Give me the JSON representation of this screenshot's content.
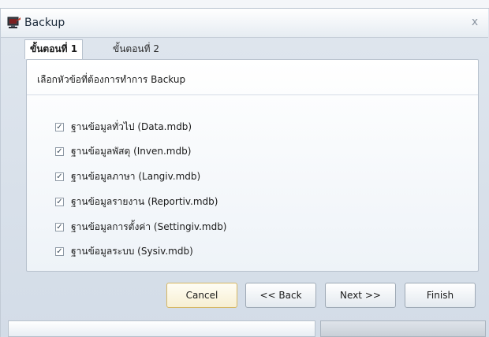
{
  "window": {
    "title": "Backup",
    "close_glyph": "x",
    "icon": "backup-monitor-icon"
  },
  "tabs": [
    {
      "label": "ขั้นตอนที่ 1",
      "active": true
    },
    {
      "label": "ขั้นตอนที่ 2",
      "active": false
    }
  ],
  "panel": {
    "instruction": "เลือกหัวข้อที่ต้องการทำการ Backup",
    "items": [
      {
        "label": "ฐานข้อมูลทั่วไป (Data.mdb)",
        "checked": true
      },
      {
        "label": "ฐานข้อมูลพัสดุ (Inven.mdb)",
        "checked": true
      },
      {
        "label": "ฐานข้อมูลภาษา (Langiv.mdb)",
        "checked": true
      },
      {
        "label": "ฐานข้อมูลรายงาน (Reportiv.mdb)",
        "checked": true
      },
      {
        "label": "ฐานข้อมูลการตั้งค่า (Settingiv.mdb)",
        "checked": true
      },
      {
        "label": "ฐานข้อมูลระบบ (Sysiv.mdb)",
        "checked": true
      }
    ]
  },
  "buttons": {
    "cancel": "Cancel",
    "back": "<< Back",
    "next": "Next >>",
    "finish": "Finish"
  },
  "colors": {
    "default_button_border": "#d6b762",
    "panel_border": "#b7c1cd"
  }
}
